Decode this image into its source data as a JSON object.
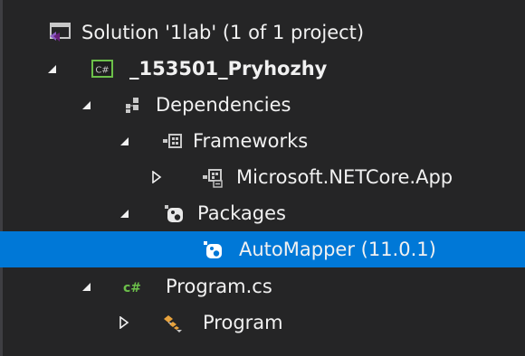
{
  "solution_explorer": {
    "items": [
      {
        "label": "Solution '1lab' (1 of 1 project)",
        "icon": "solution-icon",
        "expander": "none"
      },
      {
        "label": "_153501_Pryhozhy",
        "icon": "csharp-project-icon",
        "expander": "expanded"
      },
      {
        "label": "Dependencies",
        "icon": "dependencies-icon",
        "expander": "expanded"
      },
      {
        "label": "Frameworks",
        "icon": "frameworks-icon",
        "expander": "expanded"
      },
      {
        "label": "Microsoft.NETCore.App",
        "icon": "framework-reference-icon",
        "expander": "collapsed"
      },
      {
        "label": "Packages",
        "icon": "nuget-packages-icon",
        "expander": "expanded"
      },
      {
        "label": "AutoMapper (11.0.1)",
        "icon": "nuget-package-icon",
        "expander": "none",
        "selected": true
      },
      {
        "label": "Program.cs",
        "icon": "csharp-file-icon",
        "expander": "expanded"
      },
      {
        "label": "Program",
        "icon": "class-icon",
        "expander": "collapsed"
      }
    ]
  },
  "colors": {
    "background": "#252526",
    "selection": "#0078d7",
    "text": "#f1f1f1",
    "csharp_green": "#6cc04a",
    "solution_purple": "#68217a"
  }
}
